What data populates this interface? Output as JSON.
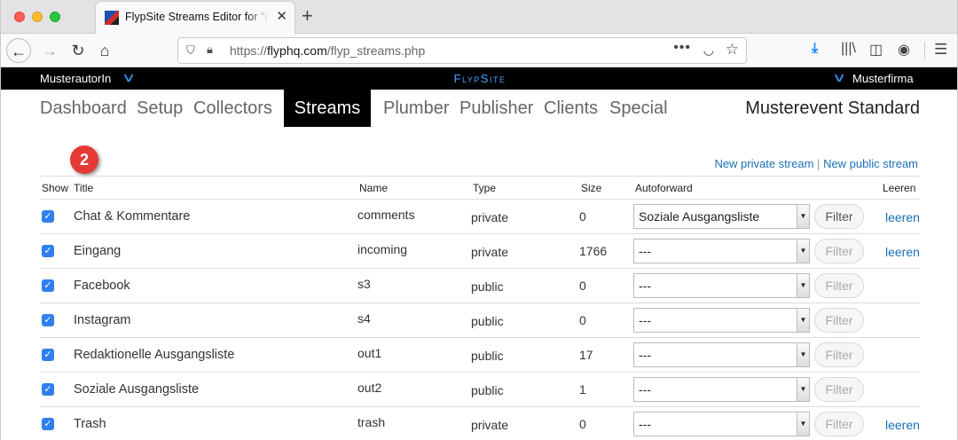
{
  "browser": {
    "tab_title": "FlypSite Streams Editor for \"mu",
    "tab_close": "✕",
    "new_tab": "+",
    "url_prefix": "https://",
    "url_host": "flyphq.com",
    "url_path": "/flyp_streams.php"
  },
  "site": {
    "user": "MusterautorIn",
    "brand": "FlypSite",
    "company": "Musterfirma",
    "event": "Musterevent Standard"
  },
  "nav": {
    "items": [
      "Dashboard",
      "Setup",
      "Collectors",
      "Streams",
      "Plumber",
      "Publisher",
      "Clients",
      "Special"
    ],
    "active": "Streams"
  },
  "badge": "2",
  "links": {
    "new_private": "New private stream",
    "separator": "|",
    "new_public": "New public stream"
  },
  "table": {
    "headers": [
      "Show",
      "Title",
      "Name",
      "Type",
      "Size",
      "Autoforward",
      "Leeren"
    ],
    "rows": [
      {
        "title": "Chat & Kommentare",
        "name": "comments",
        "type": "private",
        "size": "0",
        "autoforward": "Soziale Ausgangsliste",
        "filter": "Filter",
        "filter_enabled": true,
        "leeren": "leeren"
      },
      {
        "title": "Eingang",
        "name": "incoming",
        "type": "private",
        "size": "1766",
        "autoforward": "---",
        "filter": "Filter",
        "filter_enabled": false,
        "leeren": "leeren"
      },
      {
        "title": "Facebook",
        "name": "s3",
        "type": "public",
        "size": "0",
        "autoforward": "---",
        "filter": "Filter",
        "filter_enabled": false,
        "leeren": ""
      },
      {
        "title": "Instagram",
        "name": "s4",
        "type": "public",
        "size": "0",
        "autoforward": "---",
        "filter": "Filter",
        "filter_enabled": false,
        "leeren": ""
      },
      {
        "title": "Redaktionelle Ausgangsliste",
        "name": "out1",
        "type": "public",
        "size": "17",
        "autoforward": "---",
        "filter": "Filter",
        "filter_enabled": false,
        "leeren": ""
      },
      {
        "title": "Soziale Ausgangsliste",
        "name": "out2",
        "type": "public",
        "size": "1",
        "autoforward": "---",
        "filter": "Filter",
        "filter_enabled": false,
        "leeren": ""
      },
      {
        "title": "Trash",
        "name": "trash",
        "type": "private",
        "size": "0",
        "autoforward": "---",
        "filter": "Filter",
        "filter_enabled": false,
        "leeren": "leeren"
      }
    ]
  },
  "colors": {
    "accent_blue": "#1a6fb5",
    "brand_blue": "#4aa3ff",
    "badge_red": "#e53935",
    "checkbox_blue": "#2f80ed"
  }
}
